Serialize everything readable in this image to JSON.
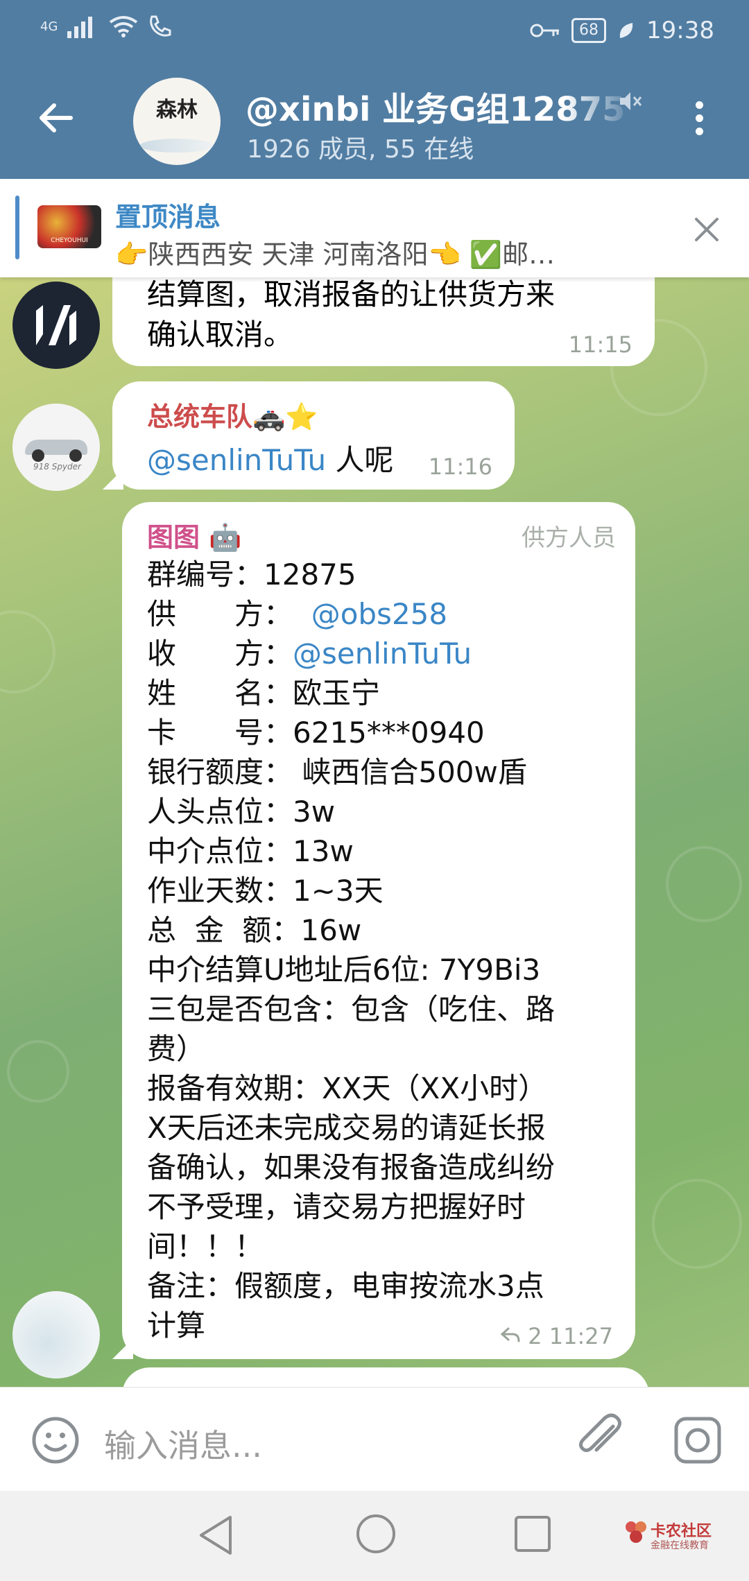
{
  "status_bar": {
    "network": "4G",
    "battery": "68",
    "time": "19:38"
  },
  "header": {
    "avatar_text": "森林",
    "title": "@xinbi 业务G组12875",
    "subtitle": "1926 成员, 55 在线"
  },
  "pinned": {
    "title": "置顶消息",
    "text": "👉陕西西安 天津 河南洛阳👈 ✅邮…",
    "thumb_text": "CHEYOUHUI"
  },
  "messages": [
    {
      "text_lines": [
        "结算图，取消报备的让供货方来",
        "确认取消。"
      ],
      "time": "11:15"
    },
    {
      "sender": "总统车队",
      "sender_emoji": "🚓⭐",
      "mention": "@senlinTuTu",
      "text": " 人呢",
      "time": "11:16",
      "avatar_tag": "918 Spyder"
    },
    {
      "sender": "图图",
      "sender_emoji": "🤖",
      "badge": "供方人员",
      "rows": [
        {
          "text": "群编号：12875"
        },
        {
          "text": "供　　方：  ",
          "mention": "@obs258"
        },
        {
          "text": "收　　方：",
          "mention": "@senlinTuTu"
        },
        {
          "text": "姓　　名：欧玉宁"
        },
        {
          "text": "卡　　号：6215***0940"
        },
        {
          "text": "银行额度： 峡西信合500w盾"
        },
        {
          "text": "人头点位：3w"
        },
        {
          "text": "中介点位：13w"
        },
        {
          "text": "作业天数：1~3天"
        },
        {
          "text": "总  金  额：16w"
        },
        {
          "text": "中介结算U地址后6位: 7Y9Bi3"
        },
        {
          "text": "三包是否包含：包含（吃住、路"
        },
        {
          "text": "费）"
        },
        {
          "text": "报备有效期：XX天（XX小时）"
        },
        {
          "text": "X天后还未完成交易的请延长报"
        },
        {
          "text": "备确认，如果没有报备造成纠纷"
        },
        {
          "text": "不予受理，请交易方把握好时"
        },
        {
          "text": "间！！！"
        },
        {
          "text": "备注：假额度，电审按流水3点"
        },
        {
          "text": "计算"
        }
      ],
      "replies": "2",
      "time": "11:27"
    }
  ],
  "input": {
    "placeholder": "输入消息..."
  },
  "watermark": {
    "name": "卡农社区",
    "sub": "金融在线教育"
  },
  "colors": {
    "header": "#517da2",
    "accent": "#3e88c5",
    "mention": "#3a86c6"
  }
}
